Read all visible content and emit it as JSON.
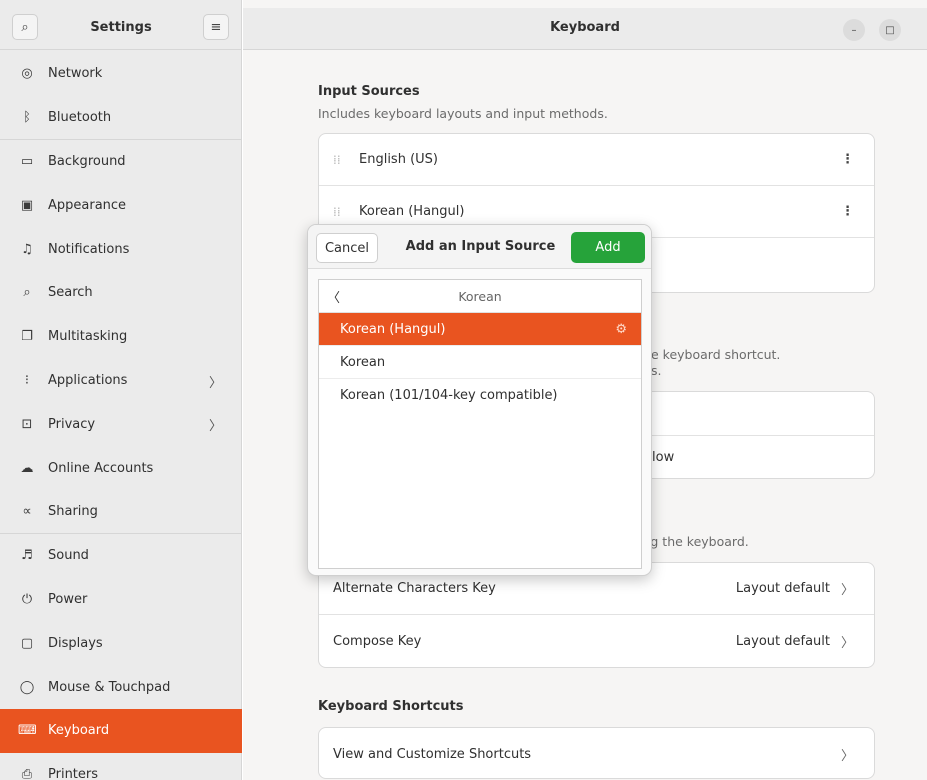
{
  "sidebar": {
    "title": "Settings",
    "search_icon": "search-icon",
    "menu_icon": "hamburger-icon",
    "items": [
      {
        "label": "Network",
        "icon": "◎"
      },
      {
        "label": "Bluetooth",
        "icon": "ᛒ"
      },
      {
        "label": "Background",
        "icon": "▭"
      },
      {
        "label": "Appearance",
        "icon": "▣"
      },
      {
        "label": "Notifications",
        "icon": "♫"
      },
      {
        "label": "Search",
        "icon": "⌕"
      },
      {
        "label": "Multitasking",
        "icon": "❐"
      },
      {
        "label": "Applications",
        "icon": "⁝"
      },
      {
        "label": "Privacy",
        "icon": "⊡"
      },
      {
        "label": "Online Accounts",
        "icon": "☁"
      },
      {
        "label": "Sharing",
        "icon": "∝"
      },
      {
        "label": "Sound",
        "icon": "♬"
      },
      {
        "label": "Power",
        "icon": "⏻"
      },
      {
        "label": "Displays",
        "icon": "▢"
      },
      {
        "label": "Mouse & Touchpad",
        "icon": "◯"
      },
      {
        "label": "Keyboard",
        "icon": "⌨"
      },
      {
        "label": "Printers",
        "icon": "⎙"
      }
    ],
    "chevron": "〉",
    "active_color": "#e95420"
  },
  "main": {
    "title": "Keyboard",
    "input_sources": {
      "title": "Input Sources",
      "subtitle": "Includes keyboard layouts and input methods.",
      "rows": [
        {
          "label": "English (US)",
          "menu": "⋮"
        },
        {
          "label": "Korean (Hangul)",
          "menu": "⋮"
        }
      ]
    },
    "peek": {
      "shortcut_line": "e keyboard shortcut.",
      "shortcut_line2": "s.",
      "row_text": "low",
      "keyboard_line": "ing the keyboard."
    },
    "special_rows": [
      {
        "label": "Alternate Characters Key",
        "value": "Layout default",
        "chevron": "〉"
      },
      {
        "label": "Compose Key",
        "value": "Layout default",
        "chevron": "〉"
      }
    ],
    "shortcuts": {
      "title": "Keyboard Shortcuts",
      "row_label": "View and Customize Shortcuts",
      "chevron": "〉"
    }
  },
  "dialog": {
    "cancel": "Cancel",
    "title": "Add an Input Source",
    "add": "Add",
    "add_color": "#26a33a",
    "back_arrow": "〈",
    "back_label": "Korean",
    "items": [
      {
        "label": "Korean (Hangul)",
        "selected": true,
        "gear": "⚙"
      },
      {
        "label": "Korean"
      },
      {
        "label": "Korean (101/104-key compatible)"
      }
    ]
  },
  "window": {
    "minimize": "–",
    "maximize": "□"
  }
}
